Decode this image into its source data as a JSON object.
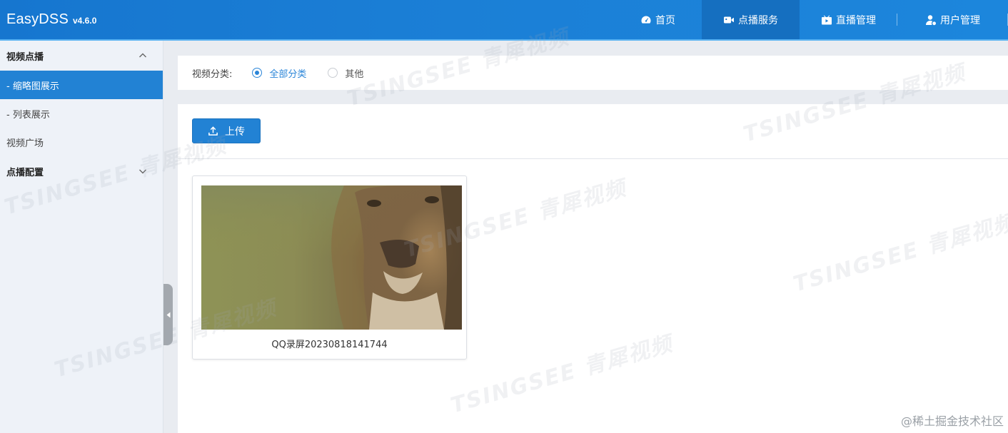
{
  "header": {
    "brand": "EasyDSS",
    "version": "v4.6.0",
    "nav": [
      {
        "label": "首页",
        "icon": "dashboard-icon"
      },
      {
        "label": "点播服务",
        "icon": "video-camera-icon",
        "active": true
      },
      {
        "label": "直播管理",
        "icon": "live-tv-icon"
      },
      {
        "label": "用户管理",
        "icon": "user-icon"
      }
    ]
  },
  "sidebar": {
    "groups": [
      {
        "label": "视频点播",
        "expanded": true,
        "items": [
          "- 缩略图展示",
          "- 列表展示",
          "视频广场"
        ]
      },
      {
        "label": "点播配置",
        "expanded": false
      }
    ],
    "active_item": "- 缩略图展示"
  },
  "filter": {
    "label": "视频分类:",
    "options": [
      {
        "label": "全部分类",
        "checked": true
      },
      {
        "label": "其他",
        "checked": false
      }
    ]
  },
  "toolbar": {
    "upload_label": "上传"
  },
  "videos": [
    {
      "title": "QQ录屏20230818141744"
    }
  ],
  "watermark": {
    "text": "TSINGSEE 青犀视频"
  },
  "corner_mark": "@稀土掘金技术社区",
  "colors": {
    "header": "#1b7fd6",
    "accent": "#2282d4",
    "sidebar_bg": "#eef2f8",
    "page_bg": "#e9ecf1"
  }
}
